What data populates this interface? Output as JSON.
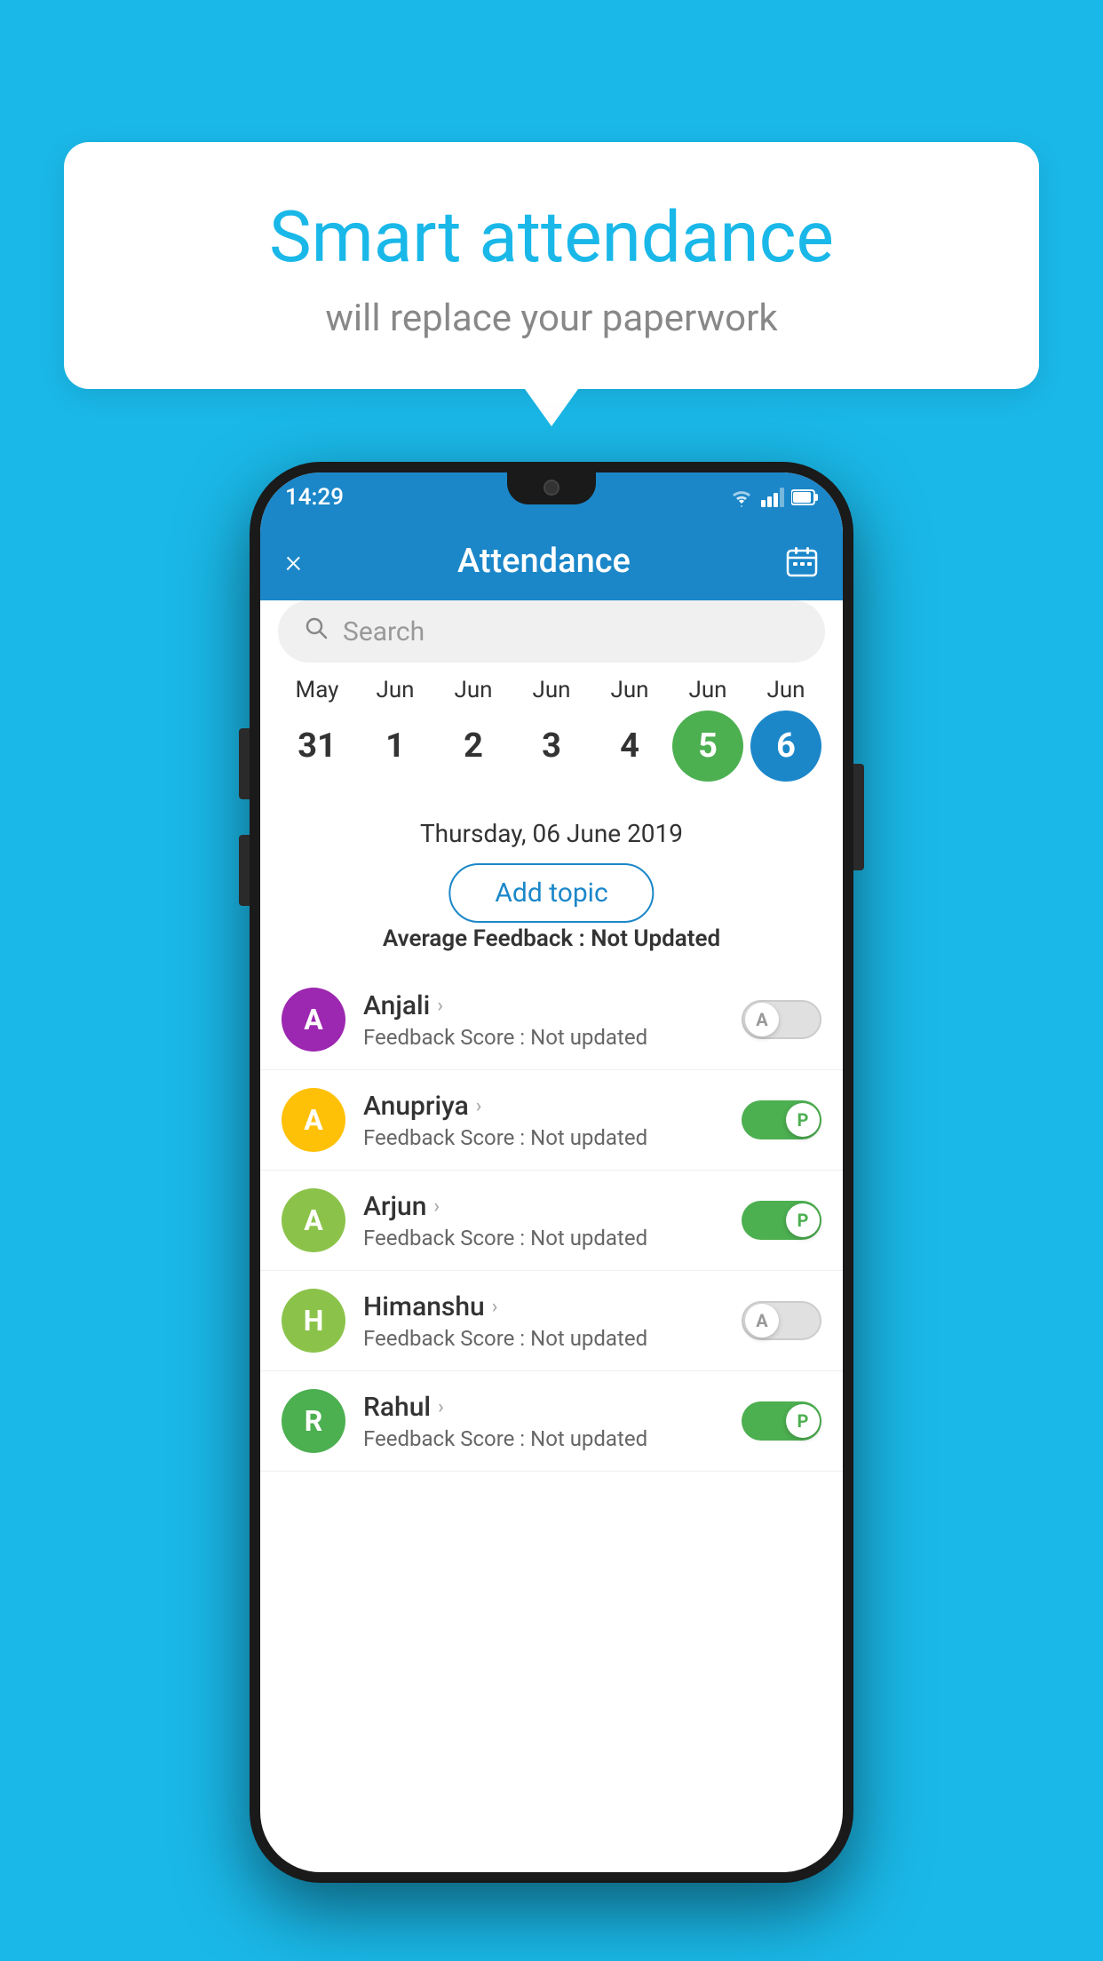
{
  "background_color": "#1ab8e8",
  "speech_bubble": {
    "title": "Smart attendance",
    "subtitle": "will replace your paperwork"
  },
  "status_bar": {
    "time": "14:29",
    "icons": [
      "wifi",
      "signal",
      "battery"
    ]
  },
  "app_header": {
    "title": "Attendance",
    "close_label": "×",
    "calendar_icon": "calendar-icon"
  },
  "search": {
    "placeholder": "Search"
  },
  "calendar": {
    "months": [
      "May",
      "Jun",
      "Jun",
      "Jun",
      "Jun",
      "Jun",
      "Jun"
    ],
    "dates": [
      "31",
      "1",
      "2",
      "3",
      "4",
      "5",
      "6"
    ],
    "today_index": 5,
    "selected_index": 6,
    "selected_date_label": "Thursday, 06 June 2019"
  },
  "add_topic": {
    "label": "Add topic"
  },
  "avg_feedback": {
    "label": "Average Feedback : ",
    "value": "Not Updated"
  },
  "students": [
    {
      "name": "Anjali",
      "avatar_letter": "A",
      "avatar_color": "#9c27b0",
      "feedback_label": "Feedback Score : ",
      "feedback_value": "Not updated",
      "toggle": "off",
      "toggle_letter": "A"
    },
    {
      "name": "Anupriya",
      "avatar_letter": "A",
      "avatar_color": "#ffc107",
      "feedback_label": "Feedback Score : ",
      "feedback_value": "Not updated",
      "toggle": "on",
      "toggle_letter": "P"
    },
    {
      "name": "Arjun",
      "avatar_letter": "A",
      "avatar_color": "#8bc34a",
      "feedback_label": "Feedback Score : ",
      "feedback_value": "Not updated",
      "toggle": "on",
      "toggle_letter": "P"
    },
    {
      "name": "Himanshu",
      "avatar_letter": "H",
      "avatar_color": "#8bc34a",
      "feedback_label": "Feedback Score : ",
      "feedback_value": "Not updated",
      "toggle": "off",
      "toggle_letter": "A"
    },
    {
      "name": "Rahul",
      "avatar_letter": "R",
      "avatar_color": "#4caf50",
      "feedback_label": "Feedback Score : ",
      "feedback_value": "Not updated",
      "toggle": "on",
      "toggle_letter": "P"
    }
  ]
}
